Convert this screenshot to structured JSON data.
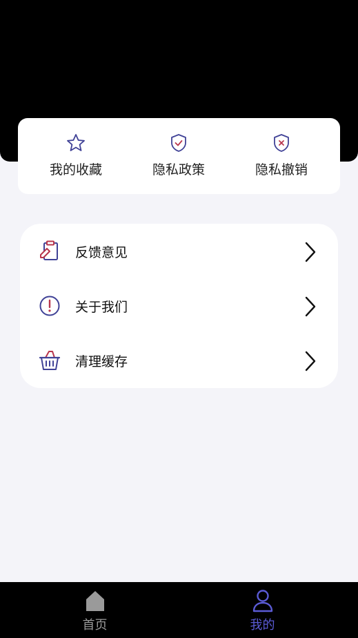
{
  "quick_actions": [
    {
      "label": "我的收藏",
      "icon": "star-icon"
    },
    {
      "label": "隐私政策",
      "icon": "shield-check-icon"
    },
    {
      "label": "隐私撤销",
      "icon": "shield-x-icon"
    }
  ],
  "menu": [
    {
      "label": "反馈意见",
      "icon": "feedback-icon"
    },
    {
      "label": "关于我们",
      "icon": "info-exclamation-icon"
    },
    {
      "label": "清理缓存",
      "icon": "basket-icon"
    }
  ],
  "tabbar": {
    "tabs": [
      {
        "label": "首页",
        "icon": "home-icon",
        "active": false
      },
      {
        "label": "我的",
        "icon": "user-icon",
        "active": true
      }
    ]
  },
  "colors": {
    "accent": "#5b5bd6",
    "icon_primary": "#3f4196",
    "icon_secondary": "#b8364d",
    "inactive_tab": "#9a9a9a",
    "background": "#f4f4f9"
  }
}
